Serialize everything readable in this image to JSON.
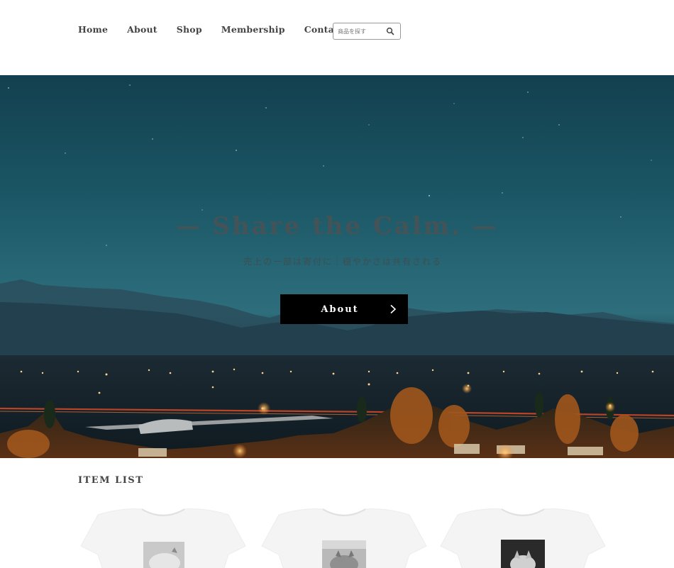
{
  "nav": {
    "items": [
      {
        "label": "Home"
      },
      {
        "label": "About"
      },
      {
        "label": "Shop"
      },
      {
        "label": "Membership"
      },
      {
        "label": "Contact"
      }
    ],
    "search_placeholder": "商品を探す",
    "search_icon": "search-icon"
  },
  "hero": {
    "title": "— Share the Calm. —",
    "subtitle": "売上の一部は寄付に｜穏やかさは共有される",
    "button_label": "About",
    "button_icon": "chevron-right-icon"
  },
  "item_list": {
    "title": "ITEM LIST",
    "items": [
      {
        "name": "tshirt-1",
        "print": "cat-photo-light"
      },
      {
        "name": "tshirt-2",
        "print": "cat-photo-gray"
      },
      {
        "name": "tshirt-3",
        "print": "cat-photo-dark"
      }
    ]
  },
  "colors": {
    "button_bg": "#000000",
    "nav_text": "#444444",
    "sky": "#1a5564"
  }
}
